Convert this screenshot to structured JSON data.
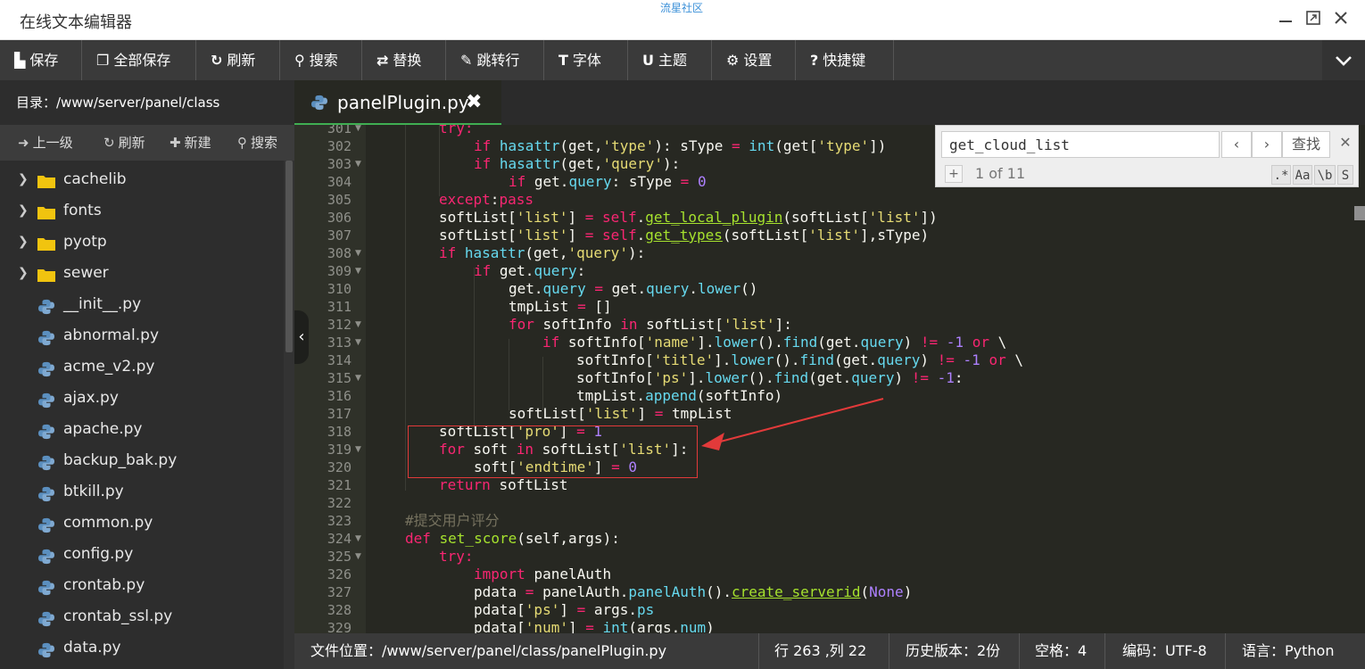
{
  "window": {
    "title": "在线文本编辑器",
    "watermark": "流星社区"
  },
  "toolbar": {
    "items": [
      {
        "label": "保存"
      },
      {
        "label": "全部保存"
      },
      {
        "label": "刷新"
      },
      {
        "label": "搜索"
      },
      {
        "label": "替换"
      },
      {
        "label": "跳转行"
      },
      {
        "label": "字体"
      },
      {
        "label": "主题"
      },
      {
        "label": "设置"
      },
      {
        "label": "快捷键"
      }
    ]
  },
  "sidebar": {
    "path_label": "目录：/www/server/panel/class",
    "actions": [
      {
        "label": "上一级"
      },
      {
        "label": "刷新"
      },
      {
        "label": "新建"
      },
      {
        "label": "搜索"
      }
    ],
    "folders": [
      "cachelib",
      "fonts",
      "pyotp",
      "sewer"
    ],
    "files": [
      "__init__.py",
      "abnormal.py",
      "acme_v2.py",
      "ajax.py",
      "apache.py",
      "backup_bak.py",
      "btkill.py",
      "common.py",
      "config.py",
      "crontab.py",
      "crontab_ssl.py",
      "data.py"
    ]
  },
  "tab": {
    "name": "panelPlugin.py",
    "close": "✖"
  },
  "search": {
    "query": "get_cloud_list",
    "find_label": "查找",
    "count": "1 of 11",
    "prev": "‹",
    "next": "›",
    "close": "✕",
    "plus": "+",
    "opts": [
      ".*",
      "Aa",
      "\\b",
      "S"
    ]
  },
  "status": {
    "file_location": "文件位置：/www/server/panel/class/panelPlugin.py",
    "cursor": "行 263 ,列 22",
    "history": "历史版本：2份",
    "spaces": "空格：4",
    "encoding": "编码：UTF-8",
    "language": "语言：Python"
  },
  "editor": {
    "lines": [
      {
        "n": "301",
        "fold": true
      },
      {
        "n": "302",
        "fold": false
      },
      {
        "n": "303",
        "fold": true
      },
      {
        "n": "304",
        "fold": false
      },
      {
        "n": "305",
        "fold": false
      },
      {
        "n": "306",
        "fold": false
      },
      {
        "n": "307",
        "fold": false
      },
      {
        "n": "308",
        "fold": true
      },
      {
        "n": "309",
        "fold": true
      },
      {
        "n": "310",
        "fold": false
      },
      {
        "n": "311",
        "fold": false
      },
      {
        "n": "312",
        "fold": true
      },
      {
        "n": "313",
        "fold": true
      },
      {
        "n": "314",
        "fold": false
      },
      {
        "n": "315",
        "fold": true
      },
      {
        "n": "316",
        "fold": false
      },
      {
        "n": "317",
        "fold": false
      },
      {
        "n": "318",
        "fold": false
      },
      {
        "n": "319",
        "fold": true
      },
      {
        "n": "320",
        "fold": false
      },
      {
        "n": "321",
        "fold": false
      },
      {
        "n": "322",
        "fold": false
      },
      {
        "n": "323",
        "fold": false
      },
      {
        "n": "324",
        "fold": true
      },
      {
        "n": "325",
        "fold": true
      },
      {
        "n": "326",
        "fold": false
      },
      {
        "n": "327",
        "fold": false
      },
      {
        "n": "328",
        "fold": false
      },
      {
        "n": "329",
        "fold": false
      }
    ],
    "code": {
      "l301": "try:",
      "l302a": "if ",
      "l302b": "hasattr",
      "l302c": "(get,",
      "l302d": "'type'",
      "l302e": "): sType ",
      "l302f": "=",
      "l302g": " ",
      "l302h": "int",
      "l302i": "(get[",
      "l302j": "'type'",
      "l302k": "])",
      "l303a": "if ",
      "l303b": "hasattr",
      "l303c": "(get,",
      "l303d": "'query'",
      "l303e": "):",
      "l304a": "if ",
      "l304b": "get.",
      "l304c": "query",
      "l304d": ": sType ",
      "l304e": "=",
      "l304f": " ",
      "l304g": "0",
      "l305a": "except",
      "l305b": ":",
      "l305c": "pass",
      "l306a": "softList[",
      "l306b": "'list'",
      "l306c": "] ",
      "l306d": "=",
      "l306e": " ",
      "l306f": "self",
      "l306g": ".",
      "l306h": "get_local_plugin",
      "l306i": "(softList[",
      "l306j": "'list'",
      "l306k": "])",
      "l307a": "softList[",
      "l307b": "'list'",
      "l307c": "] ",
      "l307d": "=",
      "l307e": " ",
      "l307f": "self",
      "l307g": ".",
      "l307h": "get_types",
      "l307i": "(softList[",
      "l307j": "'list'",
      "l307k": "],sType)",
      "l308a": "if ",
      "l308b": "hasattr",
      "l308c": "(get,",
      "l308d": "'query'",
      "l308e": "):",
      "l309a": "if ",
      "l309b": "get.",
      "l309c": "query",
      "l309d": ":",
      "l310a": "get.",
      "l310b": "query",
      "l310c": " ",
      "l310d": "=",
      "l310e": " get.",
      "l310f": "query",
      "l310g": ".",
      "l310h": "lower",
      "l310i": "()",
      "l311a": "tmpList ",
      "l311b": "=",
      "l311c": " []",
      "l312a": "for ",
      "l312b": "softInfo ",
      "l312c": "in ",
      "l312d": "softList[",
      "l312e": "'list'",
      "l312f": "]:",
      "l313a": "if ",
      "l313b": "softInfo[",
      "l313c": "'name'",
      "l313d": "].",
      "l313e": "lower",
      "l313f": "().",
      "l313g": "find",
      "l313h": "(get.",
      "l313i": "query",
      "l313j": ") ",
      "l313k": "!=",
      "l313l": " ",
      "l313m": "-1",
      "l313n": " ",
      "l313o": "or",
      "l313p": " \\",
      "l314a": "softInfo[",
      "l314b": "'title'",
      "l314c": "].",
      "l314d": "lower",
      "l314e": "().",
      "l314f": "find",
      "l314g": "(get.",
      "l314h": "query",
      "l314i": ") ",
      "l314j": "!=",
      "l314k": " ",
      "l314l": "-1",
      "l314m": " ",
      "l314n": "or",
      "l314o": " \\",
      "l315a": "softInfo[",
      "l315b": "'ps'",
      "l315c": "].",
      "l315d": "lower",
      "l315e": "().",
      "l315f": "find",
      "l315g": "(get.",
      "l315h": "query",
      "l315i": ") ",
      "l315j": "!=",
      "l315k": " ",
      "l315l": "-1",
      "l315m": ":",
      "l316a": "tmpList.",
      "l316b": "append",
      "l316c": "(softInfo)",
      "l317a": "softList[",
      "l317b": "'list'",
      "l317c": "] ",
      "l317d": "=",
      "l317e": " tmpList",
      "l318a": "softList[",
      "l318b": "'pro'",
      "l318c": "] ",
      "l318d": "=",
      "l318e": " ",
      "l318f": "1",
      "l319a": "for ",
      "l319b": "soft ",
      "l319c": "in ",
      "l319d": "softList[",
      "l319e": "'list'",
      "l319f": "]:",
      "l320a": "soft[",
      "l320b": "'endtime'",
      "l320c": "] ",
      "l320d": "=",
      "l320e": " ",
      "l320f": "0",
      "l321a": "return ",
      "l321b": "softList",
      "l323": "#提交用户评分",
      "l324a": "def ",
      "l324b": "set_score",
      "l324c": "(self,args):",
      "l325": "try:",
      "l326a": "import ",
      "l326b": "panelAuth",
      "l327a": "pdata ",
      "l327b": "=",
      "l327c": " panelAuth.",
      "l327d": "panelAuth",
      "l327e": "().",
      "l327f": "create_serverid",
      "l327g": "(",
      "l327h": "None",
      "l327i": ")",
      "l328a": "pdata[",
      "l328b": "'ps'",
      "l328c": "] ",
      "l328d": "=",
      "l328e": " args.",
      "l328f": "ps",
      "l329a": "pdata[",
      "l329b": "'num'",
      "l329c": "] ",
      "l329d": "=",
      "l329e": " ",
      "l329f": "int",
      "l329g": "(args.",
      "l329h": "num",
      "l329i": ")"
    }
  },
  "colors": {
    "accent": "#3fae52",
    "highlight": "#e23a3a",
    "bg": "#272822"
  }
}
